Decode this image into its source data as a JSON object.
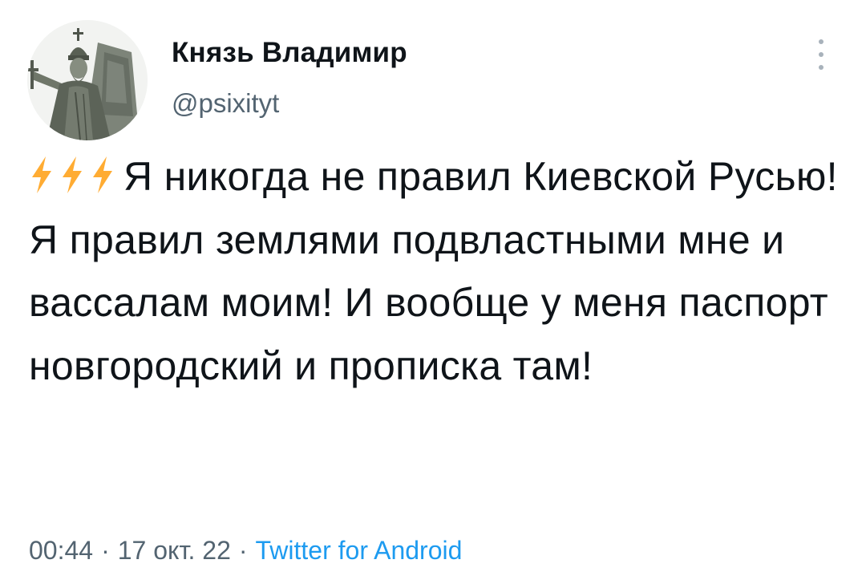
{
  "author": {
    "display_name": "Князь Владимир",
    "handle": "@psixityt",
    "avatar_icon": "statue-avatar"
  },
  "tweet": {
    "emoji": [
      "⚡",
      "⚡",
      "⚡"
    ],
    "emoji_icon": "lightning-icon",
    "text": "Я никогда не правил Киевской Русью! Я правил землями подвластными мне и вассалам моим! И вообще у меня паспорт новгородский и прописка там!"
  },
  "meta": {
    "time": "00:44",
    "separator": "·",
    "date": "17 окт. 22",
    "source": "Twitter for Android"
  },
  "colors": {
    "text": "#0f1419",
    "secondary": "#536471",
    "link": "#1d9bf0",
    "lightning": "#ffac33"
  }
}
